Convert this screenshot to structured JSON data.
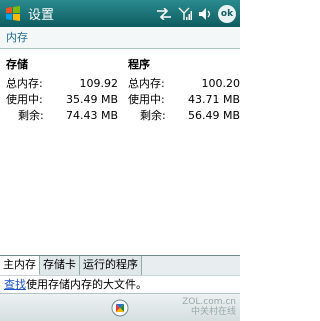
{
  "titlebar": {
    "title": "设置",
    "ok_label": "ok"
  },
  "section": {
    "header": "内存"
  },
  "storage": {
    "title": "存储",
    "rows": [
      {
        "label": "总内存:",
        "value": "109.92"
      },
      {
        "label": "使用中:",
        "value": "35.49 MB"
      },
      {
        "label": "剩余:",
        "value": "74.43 MB"
      }
    ]
  },
  "program": {
    "title": "程序",
    "rows": [
      {
        "label": "总内存:",
        "value": "100.20"
      },
      {
        "label": "使用中:",
        "value": "43.71 MB"
      },
      {
        "label": "剩余:",
        "value": "56.49 MB"
      }
    ]
  },
  "tabs": [
    {
      "label": "主内存",
      "active": true
    },
    {
      "label": "存储卡",
      "active": false
    },
    {
      "label": "运行的程序",
      "active": false
    }
  ],
  "hint": {
    "link": "查找",
    "text": "使用存储内存的大文件。"
  },
  "watermark": {
    "line1": "ZOL.com.cn",
    "line2": "中关村在线"
  }
}
